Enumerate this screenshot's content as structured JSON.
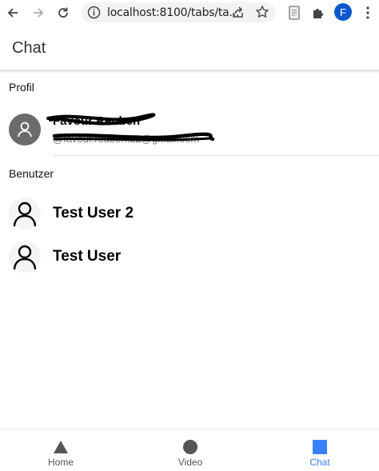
{
  "browser": {
    "url": "localhost:8100/tabs/ta...",
    "profile_initial": "F"
  },
  "header": {
    "title": "Chat"
  },
  "profile_section": {
    "label": "Profil",
    "name": "Favour Reuben",
    "email": "@favour.reuben.22@gmail.com"
  },
  "users_section": {
    "label": "Benutzer",
    "users": [
      {
        "name": "Test User 2"
      },
      {
        "name": "Test User"
      }
    ]
  },
  "tabs": [
    {
      "label": "Home",
      "icon": "triangle-icon",
      "active": false
    },
    {
      "label": "Video",
      "icon": "circle-icon",
      "active": false
    },
    {
      "label": "Chat",
      "icon": "square-icon",
      "active": true
    }
  ],
  "colors": {
    "accent": "#3880ff",
    "tab_icon": "#555555",
    "profile_badge": "#0b57d0"
  }
}
